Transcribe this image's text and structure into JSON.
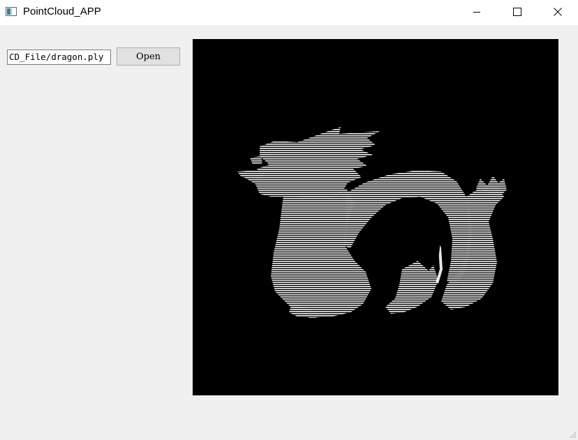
{
  "window": {
    "title": "PointCloud_APP",
    "icons": {
      "app": "app-window-icon",
      "minimize": "minimize-icon",
      "maximize": "maximize-icon",
      "close": "close-icon"
    }
  },
  "controls": {
    "file_path": "CD_File/dragon.ply",
    "open_label": "Open"
  },
  "viewer": {
    "background": "#000000",
    "point_color": "#ffffff",
    "subject": "dragon point cloud (white scan lines on black)"
  }
}
